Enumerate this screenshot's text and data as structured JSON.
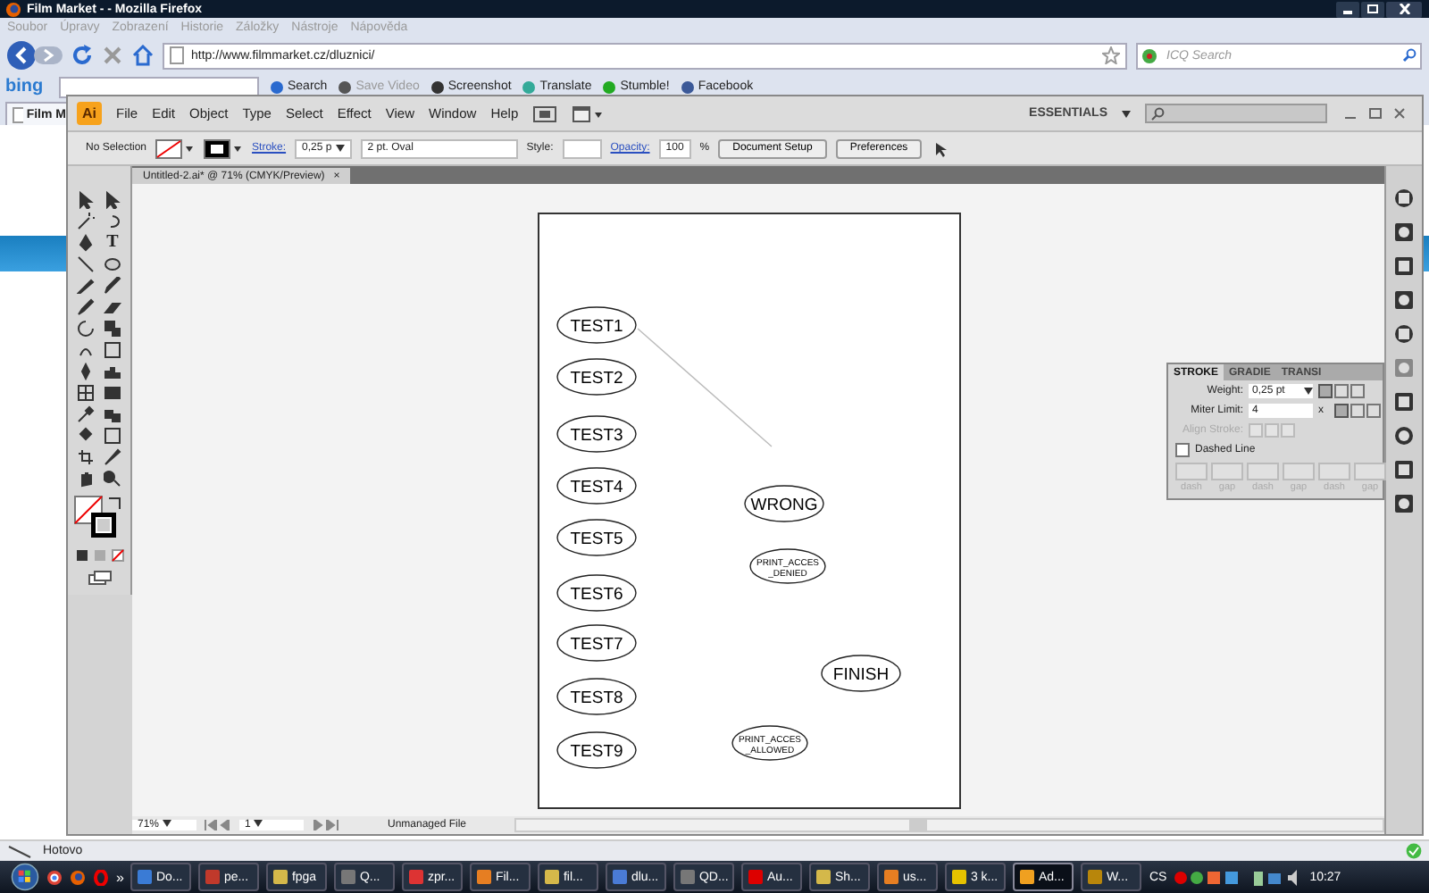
{
  "browser": {
    "title": "Film Market - - Mozilla Firefox",
    "menu": [
      "Soubor",
      "Úpravy",
      "Zobrazení",
      "Historie",
      "Záložky",
      "Nástroje",
      "Nápověda"
    ],
    "url": "http://www.filmmarket.cz/dluznici/",
    "search_placeholder": "ICQ Search",
    "toolbar": {
      "logo": "bing",
      "items": [
        {
          "label": "Search",
          "disabled": false
        },
        {
          "label": "Save Video",
          "disabled": true
        },
        {
          "label": "Screenshot",
          "disabled": false
        },
        {
          "label": "Translate",
          "disabled": false
        },
        {
          "label": "Stumble!",
          "disabled": false
        },
        {
          "label": "Facebook",
          "disabled": false
        }
      ]
    },
    "tab": "Film M",
    "status": "Hotovo"
  },
  "illustrator": {
    "logo": "Ai",
    "menu": [
      "File",
      "Edit",
      "Object",
      "Type",
      "Select",
      "Effect",
      "View",
      "Window",
      "Help"
    ],
    "workspace": "ESSENTIALS",
    "control": {
      "selection": "No Selection",
      "stroke_label": "Stroke:",
      "stroke_weight": "0,25 p",
      "brush": "2 pt. Oval",
      "style_label": "Style:",
      "opacity_label": "Opacity:",
      "opacity": "100",
      "percent": "%",
      "buttons": [
        "Document Setup",
        "Preferences"
      ]
    },
    "document_tab": "Untitled-2.ai* @ 71% (CMYK/Preview)",
    "tab_close": "×",
    "type_tool": "T",
    "nodes": [
      {
        "lines": [
          "TEST1"
        ]
      },
      {
        "lines": [
          "TEST2"
        ]
      },
      {
        "lines": [
          "TEST3"
        ]
      },
      {
        "lines": [
          "TEST4"
        ]
      },
      {
        "lines": [
          "TEST5"
        ]
      },
      {
        "lines": [
          "TEST6"
        ]
      },
      {
        "lines": [
          "TEST7"
        ]
      },
      {
        "lines": [
          "TEST8"
        ]
      },
      {
        "lines": [
          "TEST9"
        ]
      },
      {
        "lines": [
          "WRONG"
        ]
      },
      {
        "lines": [
          "PRINT_ACCES",
          "_DENIED"
        ]
      },
      {
        "lines": [
          "FINISH"
        ]
      },
      {
        "lines": [
          "PRINT_ACCES",
          "_ALLOWED"
        ]
      }
    ],
    "stroke_panel": {
      "tabs": [
        {
          "label": "STROKE",
          "selected": true
        },
        {
          "label": "GRADIE",
          "selected": false
        },
        {
          "label": "TRANSI",
          "selected": false
        }
      ],
      "weight_label": "Weight:",
      "weight": "0,25 pt",
      "miter_label": "Miter Limit:",
      "miter": "4",
      "miter_unit": "x",
      "align_label": "Align Stroke:",
      "dashed_label": "Dashed Line",
      "dashed": false,
      "dash_labels": [
        "dash",
        "gap",
        "dash",
        "gap",
        "dash",
        "gap"
      ]
    },
    "status": {
      "zoom": "71%",
      "page": "1",
      "file": "Unmanaged File"
    }
  },
  "taskbar": {
    "items": [
      {
        "label": "Do...",
        "selected": false
      },
      {
        "label": "pe...",
        "selected": false
      },
      {
        "label": "fpga",
        "selected": false
      },
      {
        "label": "Q...",
        "selected": false
      },
      {
        "label": "zpr...",
        "selected": false
      },
      {
        "label": "Fil...",
        "selected": false
      },
      {
        "label": "fil...",
        "selected": false
      },
      {
        "label": "dlu...",
        "selected": false
      },
      {
        "label": "QD...",
        "selected": false
      },
      {
        "label": "Au...",
        "selected": false
      },
      {
        "label": "Sh...",
        "selected": false
      },
      {
        "label": "us...",
        "selected": false
      },
      {
        "label": "3 k...",
        "selected": false
      },
      {
        "label": "Ad...",
        "selected": true
      },
      {
        "label": "W...",
        "selected": false
      }
    ],
    "overflow": "»",
    "language": "CS",
    "clock": "10:27"
  }
}
